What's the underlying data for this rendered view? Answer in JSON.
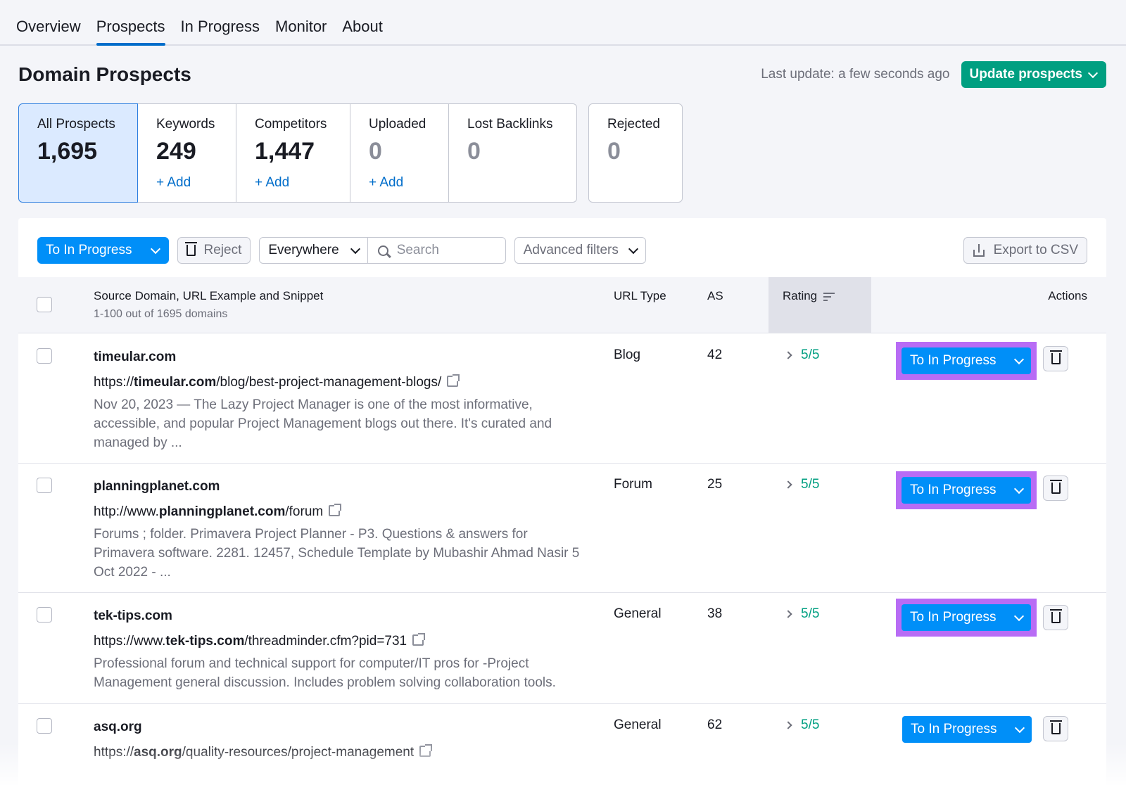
{
  "nav": {
    "tabs": [
      {
        "label": "Overview"
      },
      {
        "label": "Prospects"
      },
      {
        "label": "In Progress"
      },
      {
        "label": "Monitor"
      },
      {
        "label": "About"
      }
    ]
  },
  "header": {
    "title": "Domain Prospects",
    "last_update": "Last update: a few seconds ago",
    "update_button": "Update prospects"
  },
  "cards": [
    {
      "label": "All Prospects",
      "value": "1,695",
      "add": ""
    },
    {
      "label": "Keywords",
      "value": "249",
      "add": "+ Add"
    },
    {
      "label": "Competitors",
      "value": "1,447",
      "add": "+ Add"
    },
    {
      "label": "Uploaded",
      "value": "0",
      "add": "+ Add"
    },
    {
      "label": "Lost Backlinks",
      "value": "0",
      "add": ""
    },
    {
      "label": "Rejected",
      "value": "0",
      "add": ""
    }
  ],
  "toolbar": {
    "primary": "To In Progress",
    "reject": "Reject",
    "scope": "Everywhere",
    "search_placeholder": "Search",
    "filters": "Advanced filters",
    "export": "Export to CSV"
  },
  "table": {
    "columns": {
      "source": "Source Domain, URL Example and Snippet",
      "count": "1-100 out of 1695 domains",
      "url_type": "URL Type",
      "as": "AS",
      "rating": "Rating",
      "actions": "Actions"
    },
    "rows": [
      {
        "domain": "timeular.com",
        "url_pre": "https://",
        "url_bold": "timeular.com",
        "url_post": "/blog/best-project-management-blogs/",
        "snippet": "Nov 20, 2023 — The Lazy Project Manager is one of the most informative, accessible, and popular Project Management blogs out there. It's curated and managed by ...",
        "type": "Blog",
        "as": "42",
        "rating": "5/5",
        "action": "To In Progress"
      },
      {
        "domain": "planningplanet.com",
        "url_pre": "http://www.",
        "url_bold": "planningplanet.com",
        "url_post": "/forum",
        "snippet": "Forums ; folder. Primavera Project Planner - P3. Questions & answers for Primavera software. 2281. 12457, Schedule Template by Mubashir Ahmad Nasir 5 Oct 2022 - ...",
        "type": "Forum",
        "as": "25",
        "rating": "5/5",
        "action": "To In Progress"
      },
      {
        "domain": "tek-tips.com",
        "url_pre": "https://www.",
        "url_bold": "tek-tips.com",
        "url_post": "/threadminder.cfm?pid=731",
        "snippet": "Professional forum and technical support for computer/IT pros for -Project Management general discussion. Includes problem solving collaboration tools.",
        "type": "General",
        "as": "38",
        "rating": "5/5",
        "action": "To In Progress"
      },
      {
        "domain": "asq.org",
        "url_pre": "https://",
        "url_bold": "asq.org",
        "url_post": "/quality-resources/project-management",
        "snippet": "",
        "type": "General",
        "as": "62",
        "rating": "5/5",
        "action": "To In Progress"
      }
    ]
  },
  "colors": {
    "primary": "#008ff8",
    "update": "#009f81",
    "highlight": "#b86cf5",
    "rating": "#009f81"
  }
}
